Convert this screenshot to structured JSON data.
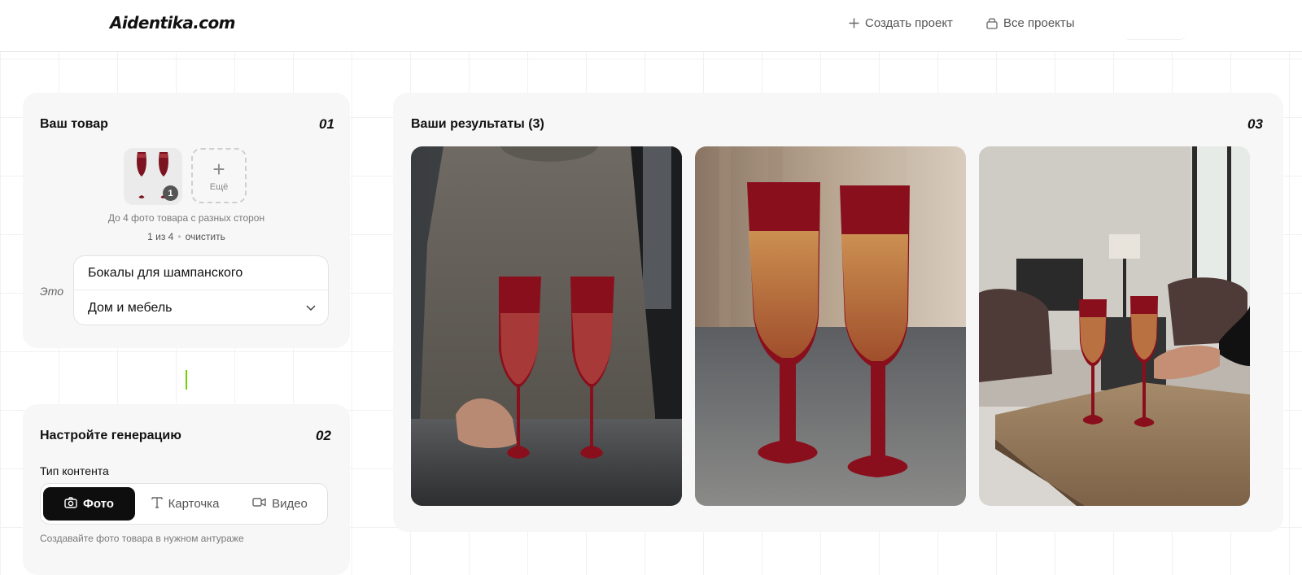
{
  "header": {
    "logo": "Aidentika.com",
    "create_project": "Создать проект",
    "all_projects": "Все проекты"
  },
  "product_card": {
    "title": "Ваш товар",
    "number": "01",
    "thumb_count": "1",
    "add_more_label": "Ещё",
    "hint": "До 4 фото товара с разных сторон",
    "photo_count": "1 из 4",
    "clear_link": "очистить",
    "eto_label": "Это",
    "product_name": "Бокалы для шампанского",
    "category": "Дом и мебель"
  },
  "generation_card": {
    "title": "Настройте генерацию",
    "number": "02",
    "content_type_label": "Тип контента",
    "tabs": [
      {
        "label": "Фото",
        "icon": "camera-icon",
        "active": true
      },
      {
        "label": "Карточка",
        "icon": "text-icon",
        "active": false
      },
      {
        "label": "Видео",
        "icon": "video-icon",
        "active": false
      }
    ],
    "description": "Создавайте фото товара в нужном антураже"
  },
  "results_card": {
    "title": "Ваши результаты (3)",
    "number": "03",
    "images": [
      {
        "icon": "result-photo-man-holding-glasses"
      },
      {
        "icon": "result-photo-glasses-closeup"
      },
      {
        "icon": "result-photo-living-room-table"
      }
    ]
  },
  "colors": {
    "accent_green": "#6cd300",
    "wine_red": "#8a0f1c",
    "active_tab": "#0e0e0e",
    "card_bg": "#f7f7f7"
  }
}
